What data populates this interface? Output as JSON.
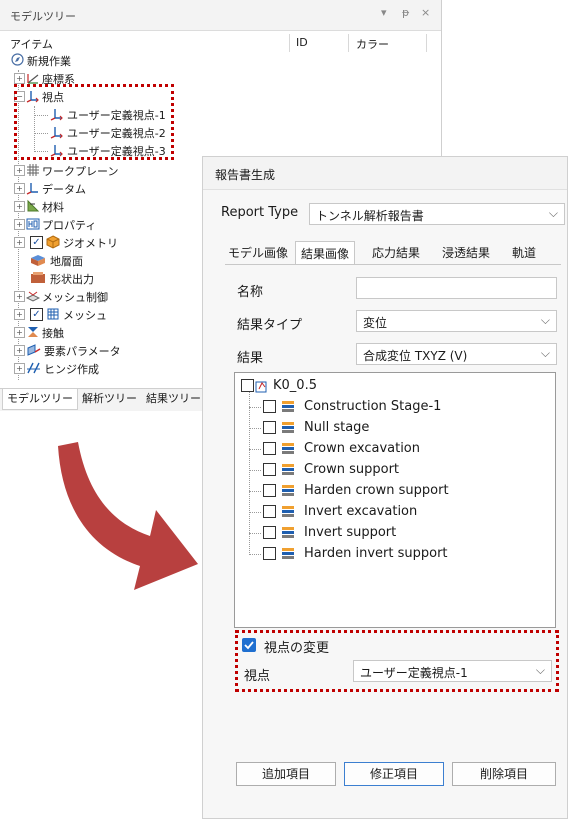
{
  "tree_panel": {
    "title": "モデルツリー",
    "controls": [
      "▾",
      "ᵽ",
      "×"
    ],
    "columns": [
      "アイテム",
      "ID",
      "カラー"
    ],
    "root": "新規作業",
    "items": [
      {
        "label": "座標系",
        "icon": "coordinate-system-icon"
      },
      {
        "label": "視点",
        "icon": "viewpoint-icon"
      },
      {
        "label": "ユーザー定義視点-1",
        "icon": "viewpoint-icon"
      },
      {
        "label": "ユーザー定義視点-2",
        "icon": "viewpoint-icon"
      },
      {
        "label": "ユーザー定義視点-3",
        "icon": "viewpoint-icon"
      },
      {
        "label": "ワークプレーン",
        "icon": "workplane-icon"
      },
      {
        "label": "データム",
        "icon": "datum-icon"
      },
      {
        "label": "材料",
        "icon": "material-icon"
      },
      {
        "label": "プロパティ",
        "icon": "property-icon"
      },
      {
        "label": "ジオメトリ",
        "icon": "geometry-icon"
      },
      {
        "label": "地層面",
        "icon": "stratum-icon"
      },
      {
        "label": "形状出力",
        "icon": "shape-output-icon"
      },
      {
        "label": "メッシュ制御",
        "icon": "mesh-control-icon"
      },
      {
        "label": "メッシュ",
        "icon": "mesh-icon"
      },
      {
        "label": "接触",
        "icon": "contact-icon"
      },
      {
        "label": "要素パラメータ",
        "icon": "element-parameter-icon"
      },
      {
        "label": "ヒンジ作成",
        "icon": "hinge-icon"
      }
    ],
    "tabs": [
      "モデルツリー",
      "解析ツリー",
      "結果ツリー"
    ]
  },
  "dialog": {
    "title": "報告書生成",
    "report_type_label": "Report Type",
    "report_type_value": "トンネル解析報告書",
    "tabs": [
      "モデル画像",
      "結果画像",
      "応力結果",
      "浸透結果",
      "軌道"
    ],
    "active_tab": "結果画像",
    "name_label": "名称",
    "name_value": "",
    "result_type_label": "結果タイプ",
    "result_type_value": "変位",
    "result_label": "結果",
    "result_value": "合成変位 TXYZ (V)",
    "result_tree": {
      "root": "K0_0.5",
      "stages": [
        "Construction Stage-1",
        "Null stage",
        "Crown excavation",
        "Crown support",
        "Harden crown support",
        "Invert excavation",
        "Invert support",
        "Harden invert support"
      ]
    },
    "change_viewpoint_label": "視点の変更",
    "change_viewpoint_checked": true,
    "viewpoint_label": "視点",
    "viewpoint_value": "ユーザー定義視点-1",
    "buttons": {
      "add": "追加項目",
      "modify": "修正項目",
      "delete": "削除項目"
    }
  },
  "colors": {
    "highlight_border": "#c00000",
    "arrow": "#b8403f",
    "checkbox_checked": "#1f6fd0"
  }
}
